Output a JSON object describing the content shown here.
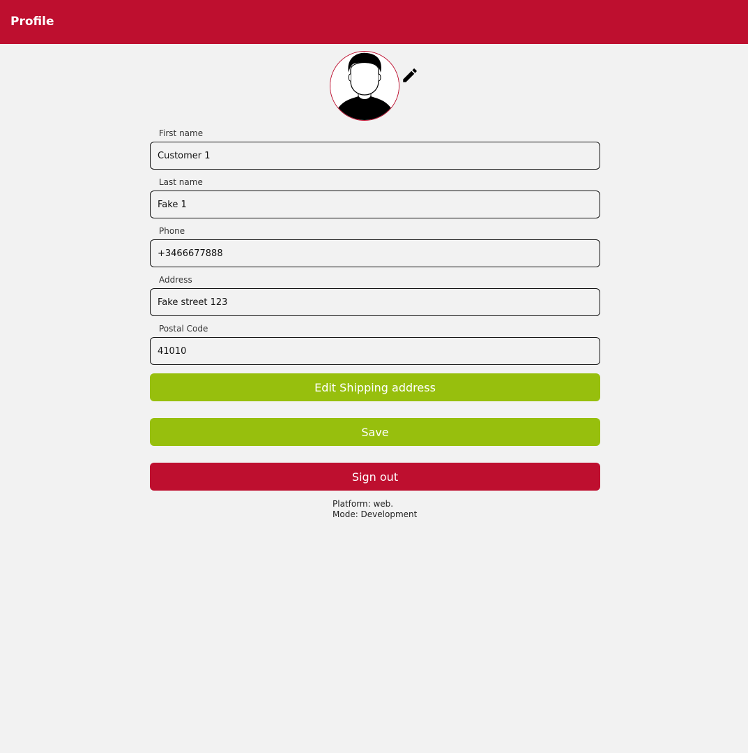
{
  "header": {
    "title": "Profile",
    "background_color": "#be0f2f"
  },
  "avatar": {
    "image": "default-user-avatar",
    "edit_icon": "pencil-icon"
  },
  "form": {
    "fields": [
      {
        "label": "First name",
        "value": "Customer 1"
      },
      {
        "label": "Last name",
        "value": "Fake 1"
      },
      {
        "label": "Phone",
        "value": "+3466677888"
      },
      {
        "label": "Address",
        "value": "Fake street 123"
      },
      {
        "label": "Postal Code",
        "value": "41010"
      }
    ]
  },
  "buttons": {
    "edit_shipping": "Edit Shipping address",
    "save": "Save",
    "sign_out": "Sign out",
    "primary_color": "#97bf0d",
    "danger_color": "#be0f2f"
  },
  "footer": {
    "platform": "Platform: web.",
    "mode": "Mode: Development"
  }
}
